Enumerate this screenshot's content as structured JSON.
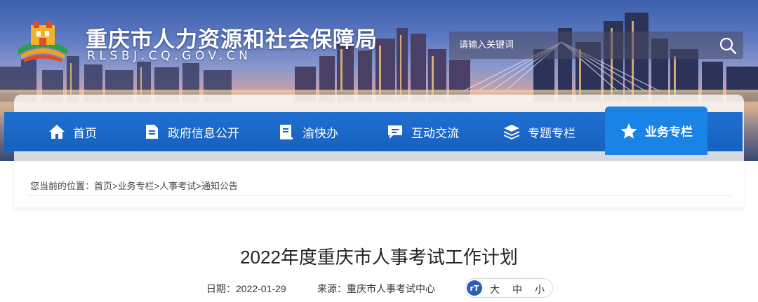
{
  "site": {
    "title": "重庆市人力资源和社会保障局",
    "domain": "RLSBJ.CQ.GOV.CN"
  },
  "search": {
    "placeholder": "请输入关键词"
  },
  "nav": {
    "items": [
      {
        "label": "首页",
        "icon": "home-icon"
      },
      {
        "label": "政府信息公开",
        "icon": "document-icon"
      },
      {
        "label": "渝快办",
        "icon": "book-icon"
      },
      {
        "label": "互动交流",
        "icon": "chat-icon"
      },
      {
        "label": "专题专栏",
        "icon": "layers-icon"
      },
      {
        "label": "业务专栏",
        "icon": "star-icon",
        "active": true
      }
    ]
  },
  "breadcrumb": {
    "prefix": "您当前的位置：",
    "items": [
      "首页",
      "业务专栏",
      "人事考试",
      "通知公告"
    ],
    "separator": ">"
  },
  "article": {
    "title": "2022年度重庆市人事考试工作计划",
    "date_label": "日期：",
    "date": "2022-01-29",
    "source_label": "来源：",
    "source": "重庆市人事考试中心",
    "font_icon": "rT",
    "font_sizes": [
      "大",
      "中",
      "小"
    ]
  },
  "colors": {
    "nav_blue": "#1761bf",
    "nav_active": "#1a84e6"
  }
}
